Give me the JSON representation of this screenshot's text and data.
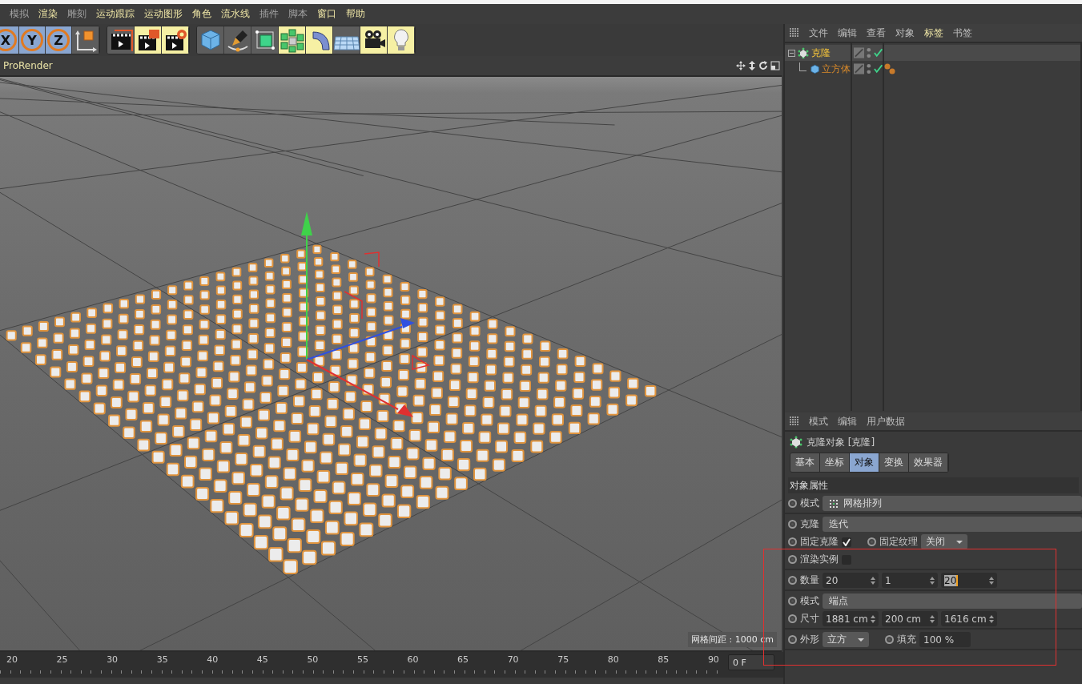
{
  "menubar": {
    "items": [
      {
        "label": "模拟",
        "dimmed": true
      },
      {
        "label": "渲染",
        "dimmed": false
      },
      {
        "label": "雕刻",
        "dimmed": true
      },
      {
        "label": "运动跟踪",
        "dimmed": false
      },
      {
        "label": "运动图形",
        "dimmed": false
      },
      {
        "label": "角色",
        "dimmed": false
      },
      {
        "label": "流水线",
        "dimmed": false
      },
      {
        "label": "插件",
        "dimmed": true
      },
      {
        "label": "脚本",
        "dimmed": true
      },
      {
        "label": "窗口",
        "dimmed": false
      },
      {
        "label": "帮助",
        "dimmed": false
      }
    ]
  },
  "toolbar": {
    "axis_buttons": [
      {
        "label": "X",
        "selected": true
      },
      {
        "label": "Y",
        "selected": true
      },
      {
        "label": "Z",
        "selected": true
      }
    ],
    "tools": [
      {
        "kind": "coordinates",
        "highlighted": false
      },
      {
        "kind": "render-view",
        "highlighted": false
      },
      {
        "kind": "render-picture",
        "highlighted": true
      },
      {
        "kind": "render-settings",
        "highlighted": true
      },
      {
        "kind": "cube",
        "highlighted": false
      },
      {
        "kind": "pen",
        "highlighted": false
      },
      {
        "kind": "subdivision",
        "highlighted": false
      },
      {
        "kind": "cloner",
        "highlighted": true
      },
      {
        "kind": "bend",
        "highlighted": true
      },
      {
        "kind": "floor",
        "highlighted": false
      },
      {
        "kind": "camera",
        "highlighted": true
      },
      {
        "kind": "light",
        "highlighted": true
      }
    ]
  },
  "viewport": {
    "title": "ProRender",
    "grid_spacing": "网格间距 : 1000 cm"
  },
  "object_manager": {
    "menu": [
      {
        "label": "文件",
        "selected": false
      },
      {
        "label": "编辑",
        "selected": false
      },
      {
        "label": "查看",
        "selected": false
      },
      {
        "label": "对象",
        "selected": false
      },
      {
        "label": "标签",
        "selected": true
      },
      {
        "label": "书签",
        "selected": false
      }
    ],
    "tree": [
      {
        "name": "克隆",
        "kind": "cloner",
        "expanded": true,
        "enabled": true,
        "tagged": false,
        "children": [
          {
            "name": "立方体",
            "kind": "cube",
            "enabled": true,
            "tagged": true
          }
        ]
      }
    ]
  },
  "attribute_manager": {
    "menu": [
      "模式",
      "编辑",
      "用户数据"
    ],
    "title": "克隆对象 [克隆]",
    "tabs": [
      {
        "label": "基本",
        "selected": false
      },
      {
        "label": "坐标",
        "selected": false
      },
      {
        "label": "对象",
        "selected": true
      },
      {
        "label": "变换",
        "selected": false
      },
      {
        "label": "效果器",
        "selected": false
      }
    ],
    "section": "对象属性",
    "groups": [
      [
        {
          "kind": "mode",
          "label": "模式",
          "value": "网格排列"
        }
      ],
      [
        {
          "kind": "dropdown",
          "label": "克隆",
          "value": "迭代"
        },
        {
          "kind": "inline",
          "items": [
            {
              "kind": "checkbox",
              "label": "固定克隆",
              "checked": true
            },
            {
              "kind": "select",
              "label": "固定纹理",
              "value": "关闭"
            }
          ]
        },
        {
          "kind": "inline",
          "items": [
            {
              "kind": "checkbox",
              "label": "渲染实例",
              "checked": false
            }
          ]
        }
      ],
      [
        {
          "kind": "numbers",
          "label": "数量",
          "values": [
            {
              "text": "20",
              "selected": false
            },
            {
              "text": "1",
              "selected": false
            },
            {
              "text": "20",
              "selected": true
            }
          ]
        }
      ],
      [
        {
          "kind": "dropdown",
          "label": "模式",
          "value": "端点"
        },
        {
          "kind": "numbers",
          "label": "尺寸",
          "values": [
            {
              "text": "1881 cm",
              "selected": false
            },
            {
              "text": "200 cm",
              "selected": false
            },
            {
              "text": "1616 cm",
              "selected": false
            }
          ]
        }
      ],
      [
        {
          "kind": "inline",
          "items": [
            {
              "kind": "select",
              "label": "外形",
              "value": "立方"
            },
            {
              "kind": "field",
              "label": "填充",
              "value": "100 %"
            }
          ]
        }
      ]
    ]
  },
  "timeline": {
    "ticks": [
      "20",
      "25",
      "30",
      "35",
      "40",
      "45",
      "50",
      "55",
      "60",
      "65",
      "70",
      "75",
      "80",
      "85",
      "90"
    ],
    "frame": "0 F"
  }
}
